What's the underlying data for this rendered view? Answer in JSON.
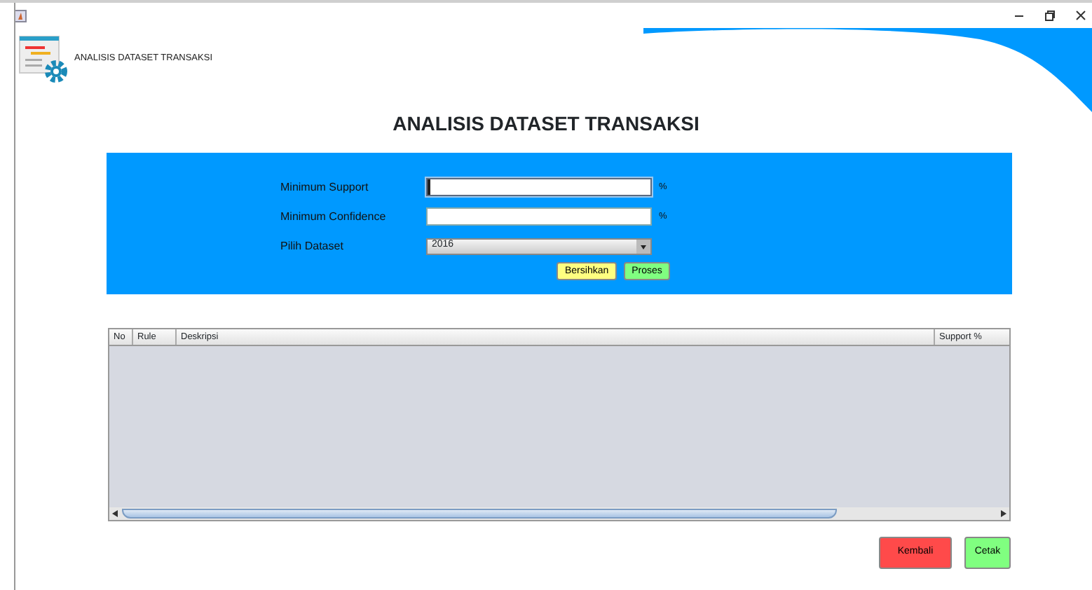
{
  "app_header": {
    "title": "ANALISIS DATASET TRANSAKSI"
  },
  "heading": "ANALISIS DATASET TRANSAKSI",
  "form": {
    "fields": [
      {
        "kind": "text",
        "label": "Minimum Support",
        "focused": true,
        "unit": "%"
      },
      {
        "kind": "text",
        "label": "Minimum Confidence",
        "focused": false,
        "unit": "%"
      },
      {
        "kind": "select",
        "label": "Pilih Dataset",
        "value": "2016"
      }
    ],
    "buttons": [
      {
        "label": "Bersihkan",
        "color": "#ffff80"
      },
      {
        "label": "Proses",
        "color": "#80ff80"
      }
    ]
  },
  "table": {
    "columns": [
      "No",
      "Rule",
      "Deskripsi",
      "Support %"
    ]
  },
  "footer_buttons": [
    {
      "label": "Kembali",
      "color": "#ff4a4a"
    },
    {
      "label": "Cetak",
      "color": "#80ff80"
    }
  ]
}
